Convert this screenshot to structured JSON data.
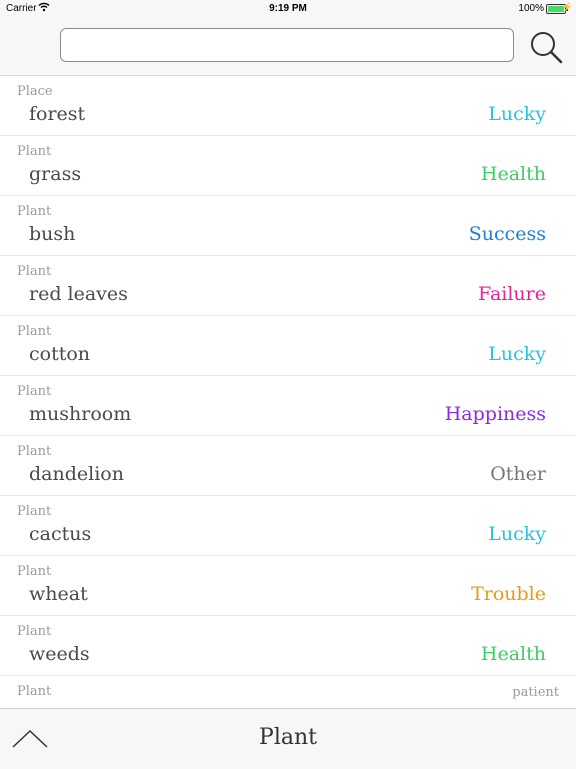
{
  "status_bar": {
    "carrier": "Carrier",
    "time": "9:19 PM",
    "battery": "100%"
  },
  "search": {
    "value": "",
    "placeholder": "",
    "icon": "search-icon"
  },
  "list": {
    "rows": [
      {
        "category": "Place",
        "name": "forest",
        "tag": "Lucky",
        "color": "#25c3df"
      },
      {
        "category": "Plant",
        "name": "grass",
        "tag": "Health",
        "color": "#3ccf63"
      },
      {
        "category": "Plant",
        "name": "bush",
        "tag": "Success",
        "color": "#1b7fd1"
      },
      {
        "category": "Plant",
        "name": "red leaves",
        "tag": "Failure",
        "color": "#e0259a"
      },
      {
        "category": "Plant",
        "name": "cotton",
        "tag": "Lucky",
        "color": "#25c3df"
      },
      {
        "category": "Plant",
        "name": "mushroom",
        "tag": "Happiness",
        "color": "#8a2be2"
      },
      {
        "category": "Plant",
        "name": "dandelion",
        "tag": "Other",
        "color": "#777777"
      },
      {
        "category": "Plant",
        "name": "cactus",
        "tag": "Lucky",
        "color": "#25c3df"
      },
      {
        "category": "Plant",
        "name": "wheat",
        "tag": "Trouble",
        "color": "#e59b17"
      },
      {
        "category": "Plant",
        "name": "weeds",
        "tag": "Health",
        "color": "#3ccf63"
      },
      {
        "category": "Plant",
        "name": "",
        "tag": "",
        "note": "patient",
        "color": "#e0259a"
      }
    ]
  },
  "bottom_bar": {
    "title": "Plant",
    "up_icon": "chevron-up-icon"
  }
}
